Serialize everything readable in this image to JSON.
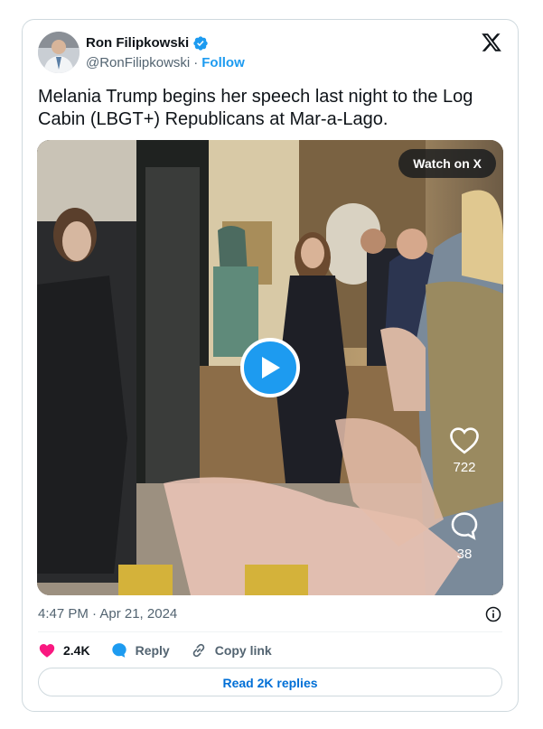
{
  "author": {
    "name": "Ron Filipkowski",
    "handle": "@RonFilipkowski",
    "separator": "·",
    "follow_label": "Follow",
    "verified_color": "#1d9bf0"
  },
  "tweet": {
    "text": "Melania Trump begins her speech last night to the Log Cabin (LBGT+) Republicans at Mar-a-Lago.",
    "timestamp": "4:47 PM · Apr 21, 2024"
  },
  "media": {
    "watch_label": "Watch on X",
    "likes_count": "722",
    "comments_count": "38",
    "icons": [
      "play-icon",
      "heart-icon",
      "comment-icon"
    ]
  },
  "actions": {
    "like_count": "2.4K",
    "reply_label": "Reply",
    "copy_label": "Copy link"
  },
  "footer": {
    "read_replies_label": "Read 2K replies"
  },
  "colors": {
    "accent": "#1d9bf0",
    "like": "#f91880",
    "text_secondary": "#536471",
    "border": "#cfd9de"
  }
}
